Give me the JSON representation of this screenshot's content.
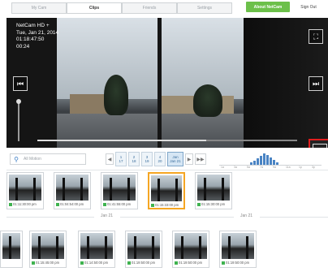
{
  "tabs": [
    {
      "label": "My Cam"
    },
    {
      "label": "Clips"
    },
    {
      "label": "Friends"
    },
    {
      "label": "Settings"
    }
  ],
  "about_button": "About NetCam",
  "sign_out": "Sign Out",
  "video": {
    "camera_name": "NetCam HD +",
    "date": "Tue, Jan 21, 2014",
    "time": "01:18:47:50",
    "duration": "00:24",
    "progress": 0.65
  },
  "search": {
    "placeholder": "All Motion"
  },
  "date_chips": [
    {
      "top": "1",
      "num": "17"
    },
    {
      "top": "2",
      "num": "18"
    },
    {
      "top": "3",
      "num": "19"
    },
    {
      "top": "4",
      "num": "20"
    },
    {
      "top": "Jan",
      "num": "Jan 21"
    }
  ],
  "histogram": {
    "values": [
      2,
      3,
      5,
      7,
      9,
      8,
      6,
      4,
      2
    ],
    "labels": [
      "1a",
      "3a",
      "5a",
      "7a",
      "9a",
      "11a",
      "1p",
      "3p"
    ]
  },
  "upper_thumbs": [
    {
      "time": "01:11:30:00 pm"
    },
    {
      "time": "01:04:54:00 pm"
    },
    {
      "time": "01:41:55:00 pm"
    },
    {
      "time": "01:15:33:00 pm"
    },
    {
      "time": "01:15:30:00 pm"
    }
  ],
  "day_labels": [
    "Jan 21",
    "Jan 21"
  ],
  "lower_thumbs": [
    {
      "time": ""
    },
    {
      "time": "01:15:45:00 pm"
    },
    {
      "time": "01:14:50:00 pm"
    },
    {
      "time": "01:19:50:00 pm"
    },
    {
      "time": "01:19:50:00 pm"
    },
    {
      "time": "01:19:50:00 pm"
    }
  ]
}
